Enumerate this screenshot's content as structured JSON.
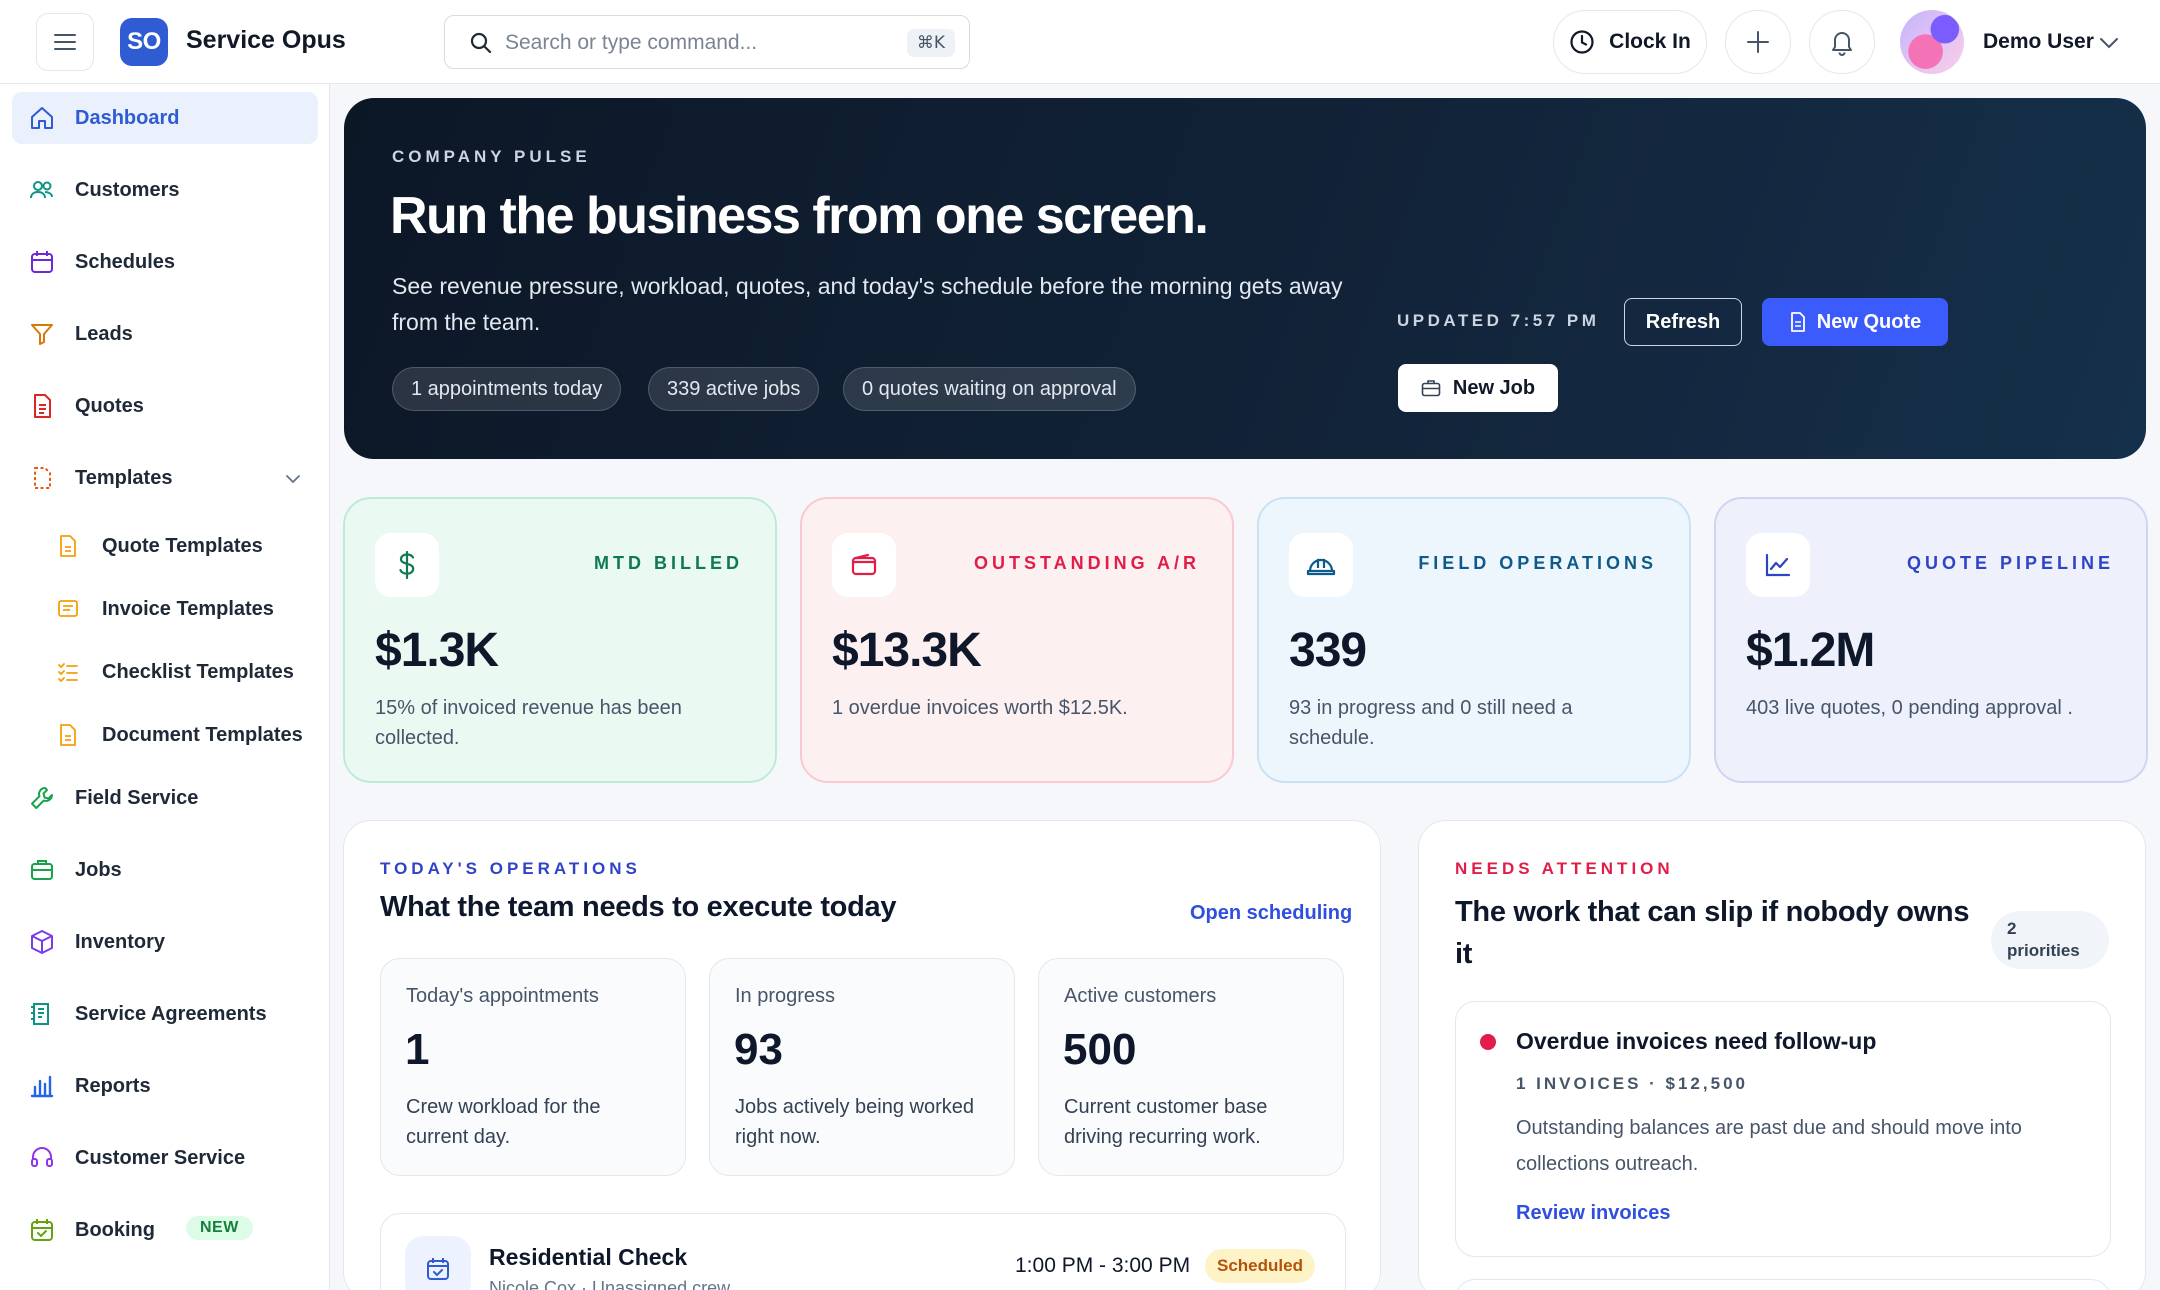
{
  "app": {
    "logo_text": "SO",
    "name": "Service Opus"
  },
  "topbar": {
    "search_placeholder": "Search or type command...",
    "search_shortcut": "⌘K",
    "clock_in_label": "Clock In",
    "user_name": "Demo User"
  },
  "sidebar": {
    "items": [
      {
        "label": "Dashboard",
        "icon": "home-icon",
        "active": true
      },
      {
        "label": "Customers",
        "icon": "users-icon"
      },
      {
        "label": "Schedules",
        "icon": "calendar-icon"
      },
      {
        "label": "Leads",
        "icon": "funnel-icon"
      },
      {
        "label": "Quotes",
        "icon": "document-icon"
      },
      {
        "label": "Templates",
        "icon": "template-icon",
        "expanded": true
      },
      {
        "label": "Quote Templates",
        "icon": "file-icon"
      },
      {
        "label": "Invoice Templates",
        "icon": "invoice-icon"
      },
      {
        "label": "Checklist Templates",
        "icon": "checklist-icon"
      },
      {
        "label": "Document Templates",
        "icon": "file-icon"
      },
      {
        "label": "Field Service",
        "icon": "wrench-icon"
      },
      {
        "label": "Jobs",
        "icon": "briefcase-icon"
      },
      {
        "label": "Inventory",
        "icon": "box-icon"
      },
      {
        "label": "Service Agreements",
        "icon": "agreement-icon"
      },
      {
        "label": "Reports",
        "icon": "bar-chart-icon"
      },
      {
        "label": "Customer Service",
        "icon": "headset-icon"
      },
      {
        "label": "Booking",
        "icon": "calendar-check-icon",
        "badge": "NEW"
      }
    ]
  },
  "hero": {
    "eyebrow": "COMPANY PULSE",
    "title": "Run the business from one screen.",
    "subtitle": "See revenue pressure, workload, quotes, and today's schedule before the morning gets away from the team.",
    "pills": [
      "1 appointments today",
      "339 active jobs",
      "0 quotes waiting on approval"
    ],
    "updated": "UPDATED 7:57 PM",
    "refresh_label": "Refresh",
    "new_quote_label": "New Quote",
    "new_job_label": "New Job"
  },
  "kpis": [
    {
      "label": "MTD BILLED",
      "value": "$1.3K",
      "desc": "15% of invoiced revenue has been collected.",
      "color": "#0f7a4f"
    },
    {
      "label": "OUTSTANDING A/R",
      "value": "$13.3K",
      "desc": "1 overdue invoices worth $12.5K.",
      "color": "#e11d48"
    },
    {
      "label": "FIELD OPERATIONS",
      "value": "339",
      "desc": "93 in progress and 0 still need a schedule.",
      "color": "#0e5a8a"
    },
    {
      "label": "QUOTE PIPELINE",
      "value": "$1.2M",
      "desc": "403 live quotes, 0 pending approval .",
      "color": "#2f43c6"
    }
  ],
  "operations": {
    "eyebrow": "TODAY'S OPERATIONS",
    "title": "What the team needs to execute today",
    "link": "Open scheduling",
    "stats": [
      {
        "label": "Today's appointments",
        "value": "1",
        "desc": "Crew workload for the current day."
      },
      {
        "label": "In progress",
        "value": "93",
        "desc": "Jobs actively being worked right now."
      },
      {
        "label": "Active customers",
        "value": "500",
        "desc": "Current customer base driving recurring work."
      }
    ],
    "appointment": {
      "title": "Residential Check",
      "subtitle": "Nicole Cox · Unassigned crew",
      "time": "1:00 PM - 3:00 PM",
      "status": "Scheduled"
    }
  },
  "attention": {
    "eyebrow": "NEEDS ATTENTION",
    "title": "The work that can slip if nobody owns it",
    "priorities_count": "2",
    "priorities_label": "priorities",
    "card": {
      "title": "Overdue invoices need follow-up",
      "meta": "1 INVOICES · $12,500",
      "desc": "Outstanding balances are past due and should move into collections outreach.",
      "link": "Review invoices"
    }
  }
}
